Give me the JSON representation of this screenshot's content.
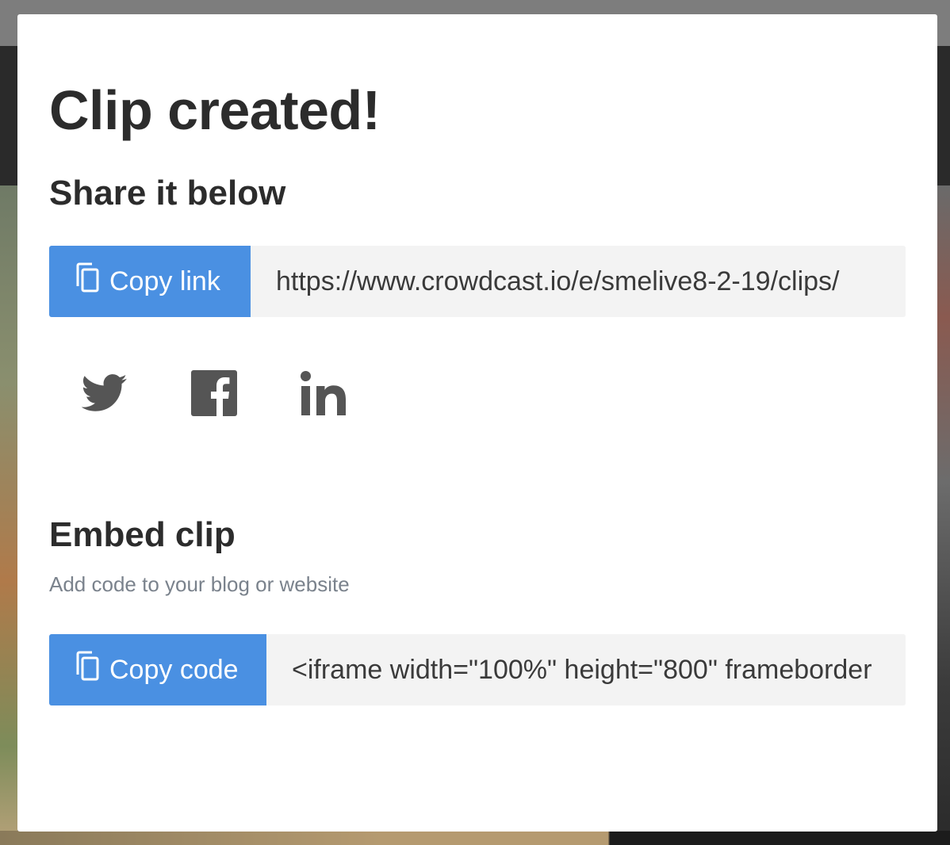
{
  "modal": {
    "title": "Clip created!",
    "share_heading": "Share it below",
    "copy_link_label": "Copy link",
    "link_value": "https://www.crowdcast.io/e/smelive8-2-19/clips/",
    "social": [
      {
        "name": "twitter",
        "icon": "twitter-icon"
      },
      {
        "name": "facebook",
        "icon": "facebook-icon"
      },
      {
        "name": "linkedin",
        "icon": "linkedin-icon"
      }
    ],
    "embed_heading": "Embed clip",
    "embed_description": "Add code to your blog or website",
    "copy_code_label": "Copy code",
    "code_value": "<iframe width=\"100%\" height=\"800\" frameborder"
  },
  "colors": {
    "accent": "#4a90e2",
    "heading": "#2c2c2c",
    "muted": "#7a828c",
    "icon": "#555555",
    "field_bg": "#f3f3f3"
  }
}
